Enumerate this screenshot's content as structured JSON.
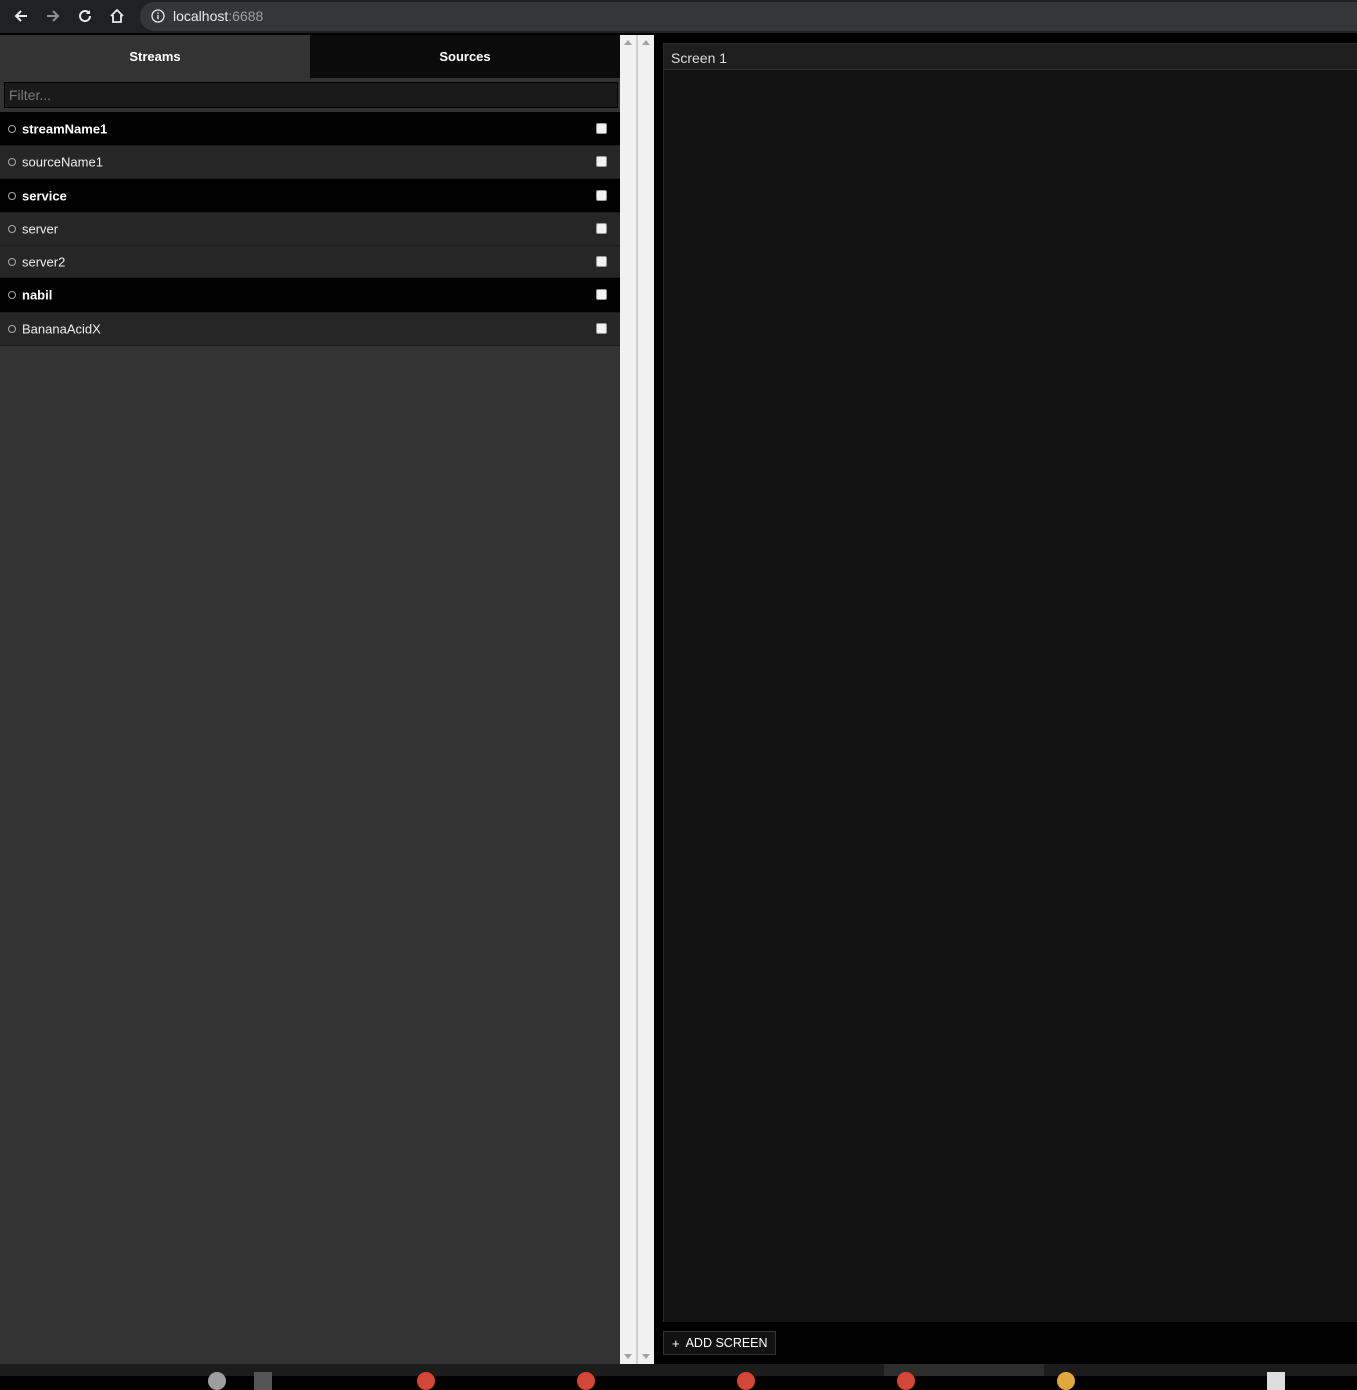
{
  "browser": {
    "url_host": "localhost",
    "url_port": ":6688"
  },
  "left_panel": {
    "tabs": [
      {
        "label": "Streams"
      },
      {
        "label": "Sources"
      }
    ],
    "filter_placeholder": "Filter...",
    "items": [
      {
        "label": "streamName1",
        "bold": true
      },
      {
        "label": "sourceName1",
        "bold": false
      },
      {
        "label": "service",
        "bold": true
      },
      {
        "label": "server",
        "bold": false
      },
      {
        "label": "server2",
        "bold": false
      },
      {
        "label": "nabil",
        "bold": true
      },
      {
        "label": "BananaAcidX",
        "bold": false
      }
    ]
  },
  "main": {
    "screen_title": "Screen 1",
    "add_screen_label": "ADD SCREEN"
  },
  "colors": {
    "panel_bg": "#333333",
    "bold_row_bg": "#000000",
    "normal_row_bg": "#262626",
    "screen_bg": "#121212"
  }
}
